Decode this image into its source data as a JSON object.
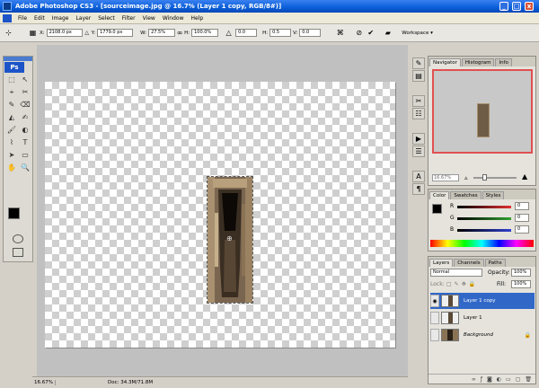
{
  "window": {
    "title": "Adobe Photoshop CS3 - [sourceimage.jpg @ 16.7% (Layer 1 copy, RGB/8#)]",
    "controls": [
      "_",
      "□",
      "x"
    ]
  },
  "menu": [
    "File",
    "Edit",
    "Image",
    "Layer",
    "Select",
    "Filter",
    "View",
    "Window",
    "Help"
  ],
  "options": {
    "x_label": "X:",
    "x_value": "2108.0 px",
    "y_label": "Y:",
    "y_value": "1779.0 px",
    "w_label": "W:",
    "w_value": "27.5%",
    "h_label": "H:",
    "h_value": "100.0%",
    "rot_value": "0.0",
    "hskew_label": "H:",
    "hskew_value": "0.5",
    "v_label": "V:",
    "v_value": "0.0",
    "workspace_label": "Workspace ▾"
  },
  "toolbox": {
    "badge": "Ps",
    "tools": [
      "⬚",
      "↖",
      "⌖",
      "✂",
      "✎",
      "⌫",
      "◭",
      "✍",
      "🖌",
      "◐",
      "⌇",
      "T",
      "➤",
      "▭",
      "✋",
      "🔍"
    ]
  },
  "status": {
    "zoom": "16.67%",
    "doc": "Doc: 34.3M/71.8M"
  },
  "navigator": {
    "tabs": [
      "Navigator",
      "Histogram",
      "Info"
    ],
    "zoom": "16.67%"
  },
  "color": {
    "tabs": [
      "Color",
      "Swatches",
      "Styles"
    ],
    "channels": [
      {
        "label": "R",
        "value": "0",
        "color": "#e03030"
      },
      {
        "label": "G",
        "value": "0",
        "color": "#30a030"
      },
      {
        "label": "B",
        "value": "0",
        "color": "#3040d0"
      }
    ]
  },
  "layers": {
    "tabs": [
      "Layers",
      "Channels",
      "Paths"
    ],
    "blend_mode": "Normal",
    "opacity_label": "Opacity:",
    "opacity_value": "100%",
    "lock_label": "Lock:",
    "fill_label": "Fill:",
    "fill_value": "100%",
    "items": [
      {
        "name": "Layer 1 copy",
        "selected": true,
        "visible": true
      },
      {
        "name": "Layer 1",
        "selected": false,
        "visible": false
      },
      {
        "name": "Background",
        "selected": false,
        "visible": false,
        "locked": true
      }
    ],
    "footer_icons": [
      "link-icon",
      "fx-icon",
      "mask-icon",
      "adjustment-icon",
      "folder-icon",
      "new-layer-icon",
      "trash-icon"
    ]
  },
  "colors": {
    "titlebar": "#0a5fd8",
    "selected_layer": "#3168c8",
    "nav_frame": "#e05050"
  }
}
